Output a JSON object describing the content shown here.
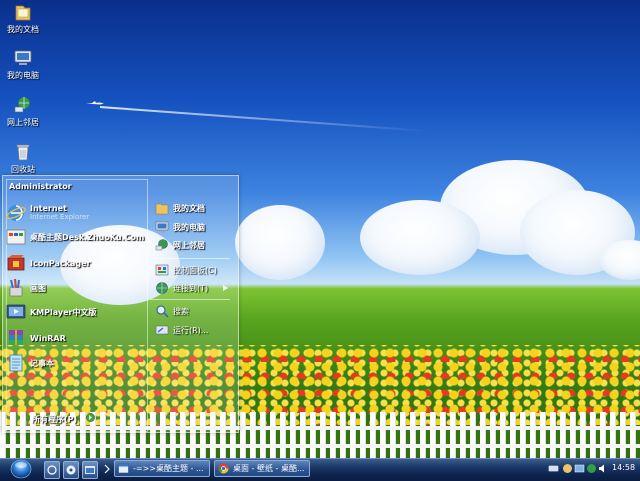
{
  "desktop": {
    "icons": [
      {
        "label": "我的文档",
        "icon": "folder-documents-icon"
      },
      {
        "label": "我的电脑",
        "icon": "computer-icon"
      },
      {
        "label": "网上邻居",
        "icon": "network-icon"
      },
      {
        "label": "回收站",
        "icon": "recycle-bin-icon"
      }
    ]
  },
  "start_menu": {
    "user": "Administrator",
    "programs": [
      {
        "title": "Internet",
        "subtitle": "Internet Explorer",
        "icon": "internet-explorer-icon"
      },
      {
        "title": "桌酷主题Desk.ZhuoKu.Com",
        "icon": "zhuoku-icon"
      },
      {
        "title": "IconPackager",
        "icon": "iconpackager-icon"
      },
      {
        "title": "画图",
        "icon": "paint-icon"
      },
      {
        "title": "KMPlayer中文版",
        "icon": "kmplayer-icon"
      },
      {
        "title": "WinRAR",
        "icon": "winrar-icon"
      },
      {
        "title": "记事本",
        "icon": "notepad-icon"
      }
    ],
    "all_programs": "所有程序(P)",
    "places": [
      {
        "label": "我的文档",
        "icon": "folder-documents-icon",
        "bold": true
      },
      {
        "label": "我的电脑",
        "icon": "computer-icon",
        "bold": true
      },
      {
        "label": "网上邻居",
        "icon": "network-icon",
        "bold": true
      },
      {
        "label": "控制面板(C)",
        "icon": "control-panel-icon",
        "bold": false
      },
      {
        "label": "连接到(T)",
        "icon": "connect-icon",
        "bold": false
      },
      {
        "label": "搜索",
        "icon": "search-icon",
        "bold": false
      },
      {
        "label": "运行(R)...",
        "icon": "run-icon",
        "bold": false
      }
    ]
  },
  "taskbar": {
    "tasks": [
      {
        "label": "-=>>桌酷主题 - ...",
        "icon": "window-icon"
      },
      {
        "label": "桌面 - 壁纸 - 桌酷...",
        "icon": "chrome-icon"
      }
    ],
    "clock": "14:58"
  }
}
